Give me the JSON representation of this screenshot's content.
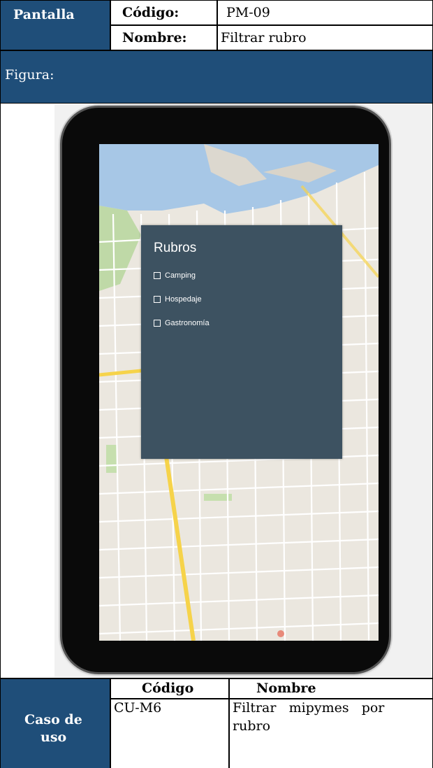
{
  "header": {
    "pantalla_label": "Pantalla",
    "codigo_label": "Código:",
    "codigo_value": "PM-09",
    "nombre_label": "Nombre:",
    "nombre_value": "Filtrar rubro"
  },
  "figura_label": "Figura:",
  "mockup": {
    "panel_title": "Rubros",
    "options": [
      "Camping",
      "Hospedaje",
      "Gastronomía"
    ],
    "icons": [
      "checkbox-icon"
    ]
  },
  "use_case": {
    "label_line1": "Caso de",
    "label_line2": "uso",
    "col_codigo": "Código",
    "col_nombre": "Nombre",
    "codigo": "CU-M6",
    "nombre_line1": "Filtrar   mipymes   por",
    "nombre_line2": "rubro"
  },
  "colors": {
    "header_blue": "#1f4e79",
    "panel": "#3d5261"
  }
}
